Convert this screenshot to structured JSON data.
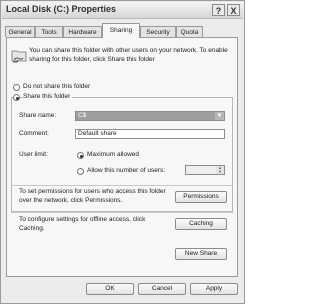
{
  "window": {
    "title": "Local Disk (C:) Properties",
    "help_button": "?",
    "close_button": "X"
  },
  "tabs": [
    {
      "label": "General"
    },
    {
      "label": "Tools"
    },
    {
      "label": "Hardware"
    },
    {
      "label": "Sharing",
      "active": true
    },
    {
      "label": "Security"
    },
    {
      "label": "Quota"
    }
  ],
  "sharing": {
    "description": "You can share this folder with other users on your network. To enable sharing for this folder, click Share this folder",
    "do_not_share_label": "Do not share this folder",
    "share_label": "Share this folder",
    "share_name_label": "Share name:",
    "share_name_value": "C$",
    "comment_label": "Comment:",
    "comment_value": "Default share",
    "user_limit_label": "User limit:",
    "max_allowed_label": "Maximum allowed",
    "allow_users_label": "Allow this number of users:",
    "permissions_text": "To set permissions for users who access this folder over the network, click Permissions.",
    "permissions_button": "Permissions",
    "caching_text": "To configure settings for offline access, click Caching.",
    "caching_button": "Caching",
    "new_share_button": "New Share"
  },
  "footer": {
    "ok": "OK",
    "cancel": "Cancel",
    "apply": "Apply"
  },
  "colors": {
    "window_bg": "#ececec",
    "panel_bg": "#f7f7f7",
    "border": "#9b9b9b"
  }
}
